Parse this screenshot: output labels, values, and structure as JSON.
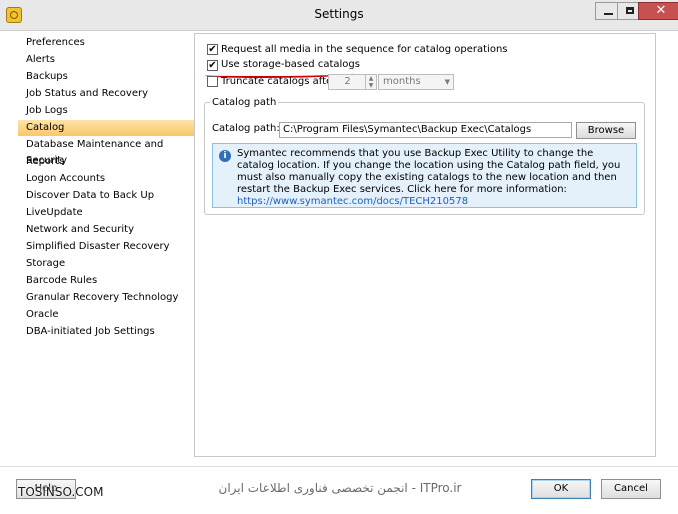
{
  "window": {
    "title": "Settings",
    "close_glyph": "✕"
  },
  "nav": {
    "items": [
      "Preferences",
      "Alerts",
      "Backups",
      "Job Status and Recovery",
      "Job Logs",
      "Catalog",
      "Database Maintenance and Security",
      "Reports",
      "Logon Accounts",
      "Discover Data to Back Up",
      "LiveUpdate",
      "Network and Security",
      "Simplified Disaster Recovery",
      "Storage",
      "Barcode Rules",
      "Granular Recovery Technology",
      "Oracle",
      "DBA-initiated Job Settings"
    ],
    "selected_index": 5
  },
  "catalog": {
    "request_all_media": {
      "label": "Request all media in the sequence for catalog operations",
      "checked": true,
      "mark": "✔"
    },
    "storage_based": {
      "label": "Use storage-based catalogs",
      "checked": true,
      "mark": "✔"
    },
    "truncate": {
      "label": "Truncate catalogs after",
      "checked": false,
      "value": "2",
      "unit": "months"
    },
    "path_group": {
      "legend": "Catalog path",
      "field_label": "Catalog path:",
      "value": "C:\\Program Files\\Symantec\\Backup Exec\\Catalogs",
      "browse_label": "Browse"
    },
    "info": {
      "icon": "info-icon",
      "text": "Symantec recommends that you use Backup Exec Utility to change the catalog location. If you change the location using the Catalog path field, you must also manually copy the existing catalogs to the new location and then restart the Backup Exec services. Click here for more information: ",
      "link": "https://www.symantec.com/docs/TECH210578"
    }
  },
  "footer": {
    "help_label": "Help",
    "ok_label": "OK",
    "cancel_label": "Cancel",
    "watermark_left": "TOSINSO.COM",
    "watermark_center": "انجمن تخصصی فناوری اطلاعات ایران - ITPro.ir"
  },
  "colors": {
    "selection": "#f9c76a",
    "info_bg": "#e4f1fb",
    "link": "#1f5fbf",
    "annotation": "#d00000"
  }
}
